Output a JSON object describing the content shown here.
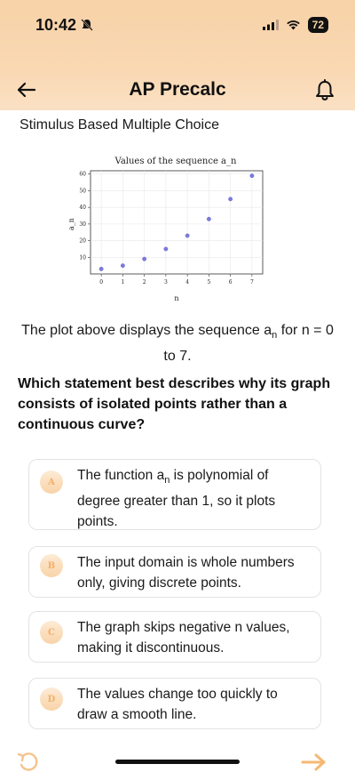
{
  "status_bar": {
    "time": "10:42",
    "battery": "72"
  },
  "header": {
    "title": "AP Precalc"
  },
  "section": {
    "title": "Stimulus Based Multiple Choice"
  },
  "chart_data": {
    "type": "scatter",
    "title": "Values of the sequence a_n",
    "xlabel": "n",
    "ylabel": "a_n",
    "x": [
      0,
      1,
      2,
      3,
      4,
      5,
      6,
      7
    ],
    "y": [
      3,
      5,
      9,
      15,
      23,
      33,
      45,
      59
    ],
    "xlim": [
      -0.5,
      7.5
    ],
    "ylim": [
      0,
      62
    ],
    "xticks": [
      "0",
      "1",
      "2",
      "3",
      "4",
      "5",
      "6",
      "7"
    ],
    "yticks": [
      "10",
      "20",
      "30",
      "40",
      "50",
      "60"
    ],
    "grid": true,
    "colors": {
      "point": "#7b7bdc",
      "grid": "#e8e8e8"
    }
  },
  "description": {
    "prefix": "The plot above displays the sequence a",
    "sub": "n",
    "suffix": " for n = 0 to 7."
  },
  "question": "Which statement best describes why its graph consists of isolated points rather than a continuous curve?",
  "options": [
    {
      "letter": "A",
      "text_prefix": "The function a",
      "text_sub": "n",
      "text_suffix": " is polynomial of degree greater than 1, so it plots points."
    },
    {
      "letter": "B",
      "text": "The input domain is whole numbers only, giving discrete points."
    },
    {
      "letter": "C",
      "text": "The graph skips negative n values, making it discontinuous."
    },
    {
      "letter": "D",
      "text": "The values change too quickly to draw a smooth line."
    }
  ],
  "colors": {
    "accent": "#f3b06a",
    "header_bg": "#f8d2a8"
  }
}
